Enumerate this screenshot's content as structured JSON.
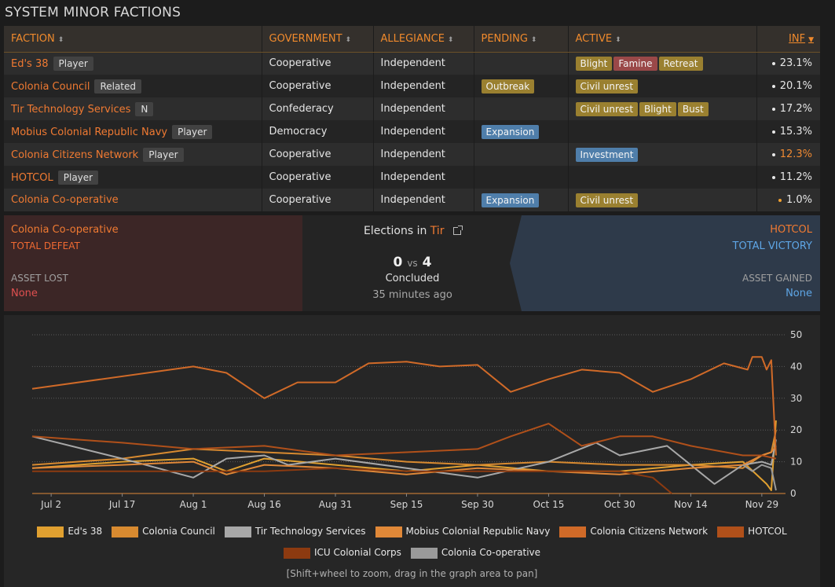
{
  "page_title": "SYSTEM MINOR FACTIONS",
  "table": {
    "headers": [
      {
        "label": "FACTION",
        "sort": "both"
      },
      {
        "label": "GOVERNMENT",
        "sort": "both"
      },
      {
        "label": "ALLEGIANCE",
        "sort": "both"
      },
      {
        "label": "PENDING",
        "sort": "both"
      },
      {
        "label": "ACTIVE",
        "sort": "both"
      },
      {
        "label": "INF",
        "sort": "desc"
      }
    ],
    "rows": [
      {
        "name": "Ed's 38",
        "tag": "Player",
        "government": "Cooperative",
        "allegiance": "Independent",
        "pending": [],
        "active": [
          {
            "label": "Blight",
            "color": "gold"
          },
          {
            "label": "Famine",
            "color": "red"
          },
          {
            "label": "Retreat",
            "color": "gold"
          }
        ],
        "inf": "23.1%",
        "inf_highlight": false
      },
      {
        "name": "Colonia Council",
        "tag": "Related",
        "government": "Cooperative",
        "allegiance": "Independent",
        "pending": [
          {
            "label": "Outbreak",
            "color": "gold"
          }
        ],
        "active": [
          {
            "label": "Civil unrest",
            "color": "gold"
          }
        ],
        "inf": "20.1%",
        "inf_highlight": false
      },
      {
        "name": "Tir Technology Services",
        "tag": "N",
        "government": "Confederacy",
        "allegiance": "Independent",
        "pending": [],
        "active": [
          {
            "label": "Civil unrest",
            "color": "gold"
          },
          {
            "label": "Blight",
            "color": "gold"
          },
          {
            "label": "Bust",
            "color": "gold"
          }
        ],
        "inf": "17.2%",
        "inf_highlight": false
      },
      {
        "name": "Mobius Colonial Republic Navy",
        "tag": "Player",
        "government": "Democracy",
        "allegiance": "Independent",
        "pending": [
          {
            "label": "Expansion",
            "color": "blue"
          }
        ],
        "active": [],
        "inf": "15.3%",
        "inf_highlight": false
      },
      {
        "name": "Colonia Citizens Network",
        "tag": "Player",
        "government": "Cooperative",
        "allegiance": "Independent",
        "pending": [],
        "active": [
          {
            "label": "Investment",
            "color": "blue"
          }
        ],
        "inf": "12.3%",
        "inf_highlight": true
      },
      {
        "name": "HOTCOL",
        "tag": "Player",
        "government": "Cooperative",
        "allegiance": "Independent",
        "pending": [],
        "active": [],
        "inf": "11.2%",
        "inf_highlight": false
      },
      {
        "name": "Colonia Co-operative",
        "tag": "",
        "government": "Cooperative",
        "allegiance": "Independent",
        "pending": [
          {
            "label": "Expansion",
            "color": "blue"
          }
        ],
        "active": [
          {
            "label": "Civil unrest",
            "color": "gold"
          }
        ],
        "inf": "1.0%",
        "inf_highlight": true
      }
    ]
  },
  "conflict": {
    "left_faction": "Colonia Co-operative",
    "left_result": "TOTAL DEFEAT",
    "left_asset_label": "ASSET LOST",
    "left_asset": "None",
    "title_prefix": "Elections in",
    "title_system": "Tir",
    "score_left": "0",
    "score_vs": "vs",
    "score_right": "4",
    "status": "Concluded",
    "time": "35 minutes ago",
    "right_faction": "HOTCOL",
    "right_result": "TOTAL VICTORY",
    "right_asset_label": "ASSET GAINED",
    "right_asset": "None"
  },
  "chart_hint": "[Shift+wheel to zoom, drag in the graph area to pan]",
  "chart_data": {
    "type": "line",
    "title": "",
    "xlabel": "",
    "ylabel": "",
    "x_ticks": [
      "Jul 2",
      "Jul 17",
      "Aug 1",
      "Aug 16",
      "Aug 31",
      "Sep 15",
      "Sep 30",
      "Oct 15",
      "Oct 30",
      "Nov 14",
      "Nov 29"
    ],
    "y_ticks": [
      0,
      10,
      20,
      30,
      40,
      50
    ],
    "ylim": [
      0,
      50
    ],
    "x_days_range": [
      -4,
      155
    ],
    "grid": true,
    "legend_position": "bottom",
    "series": [
      {
        "name": "Ed's 38",
        "color": "#e0a030",
        "points": [
          [
            -4,
            8
          ],
          [
            15,
            10
          ],
          [
            30,
            11
          ],
          [
            37,
            7
          ],
          [
            45,
            11
          ],
          [
            60,
            9
          ],
          [
            75,
            7
          ],
          [
            90,
            9
          ],
          [
            105,
            7
          ],
          [
            120,
            7
          ],
          [
            135,
            9
          ],
          [
            146,
            10
          ],
          [
            151,
            3
          ],
          [
            152,
            1
          ],
          [
            153,
            23
          ]
        ]
      },
      {
        "name": "Colonia Council",
        "color": "#d88a30",
        "points": [
          [
            -4,
            9
          ],
          [
            15,
            11
          ],
          [
            30,
            14
          ],
          [
            45,
            13
          ],
          [
            60,
            12
          ],
          [
            75,
            10
          ],
          [
            90,
            9
          ],
          [
            105,
            10
          ],
          [
            120,
            9
          ],
          [
            135,
            9
          ],
          [
            146,
            8
          ],
          [
            150,
            12
          ],
          [
            152,
            13
          ],
          [
            153,
            20
          ]
        ]
      },
      {
        "name": "Tir Technology Services",
        "color": "#a8a8a8",
        "points": [
          [
            -4,
            18
          ],
          [
            15,
            11
          ],
          [
            30,
            5
          ],
          [
            37,
            11
          ],
          [
            45,
            12
          ],
          [
            50,
            9
          ],
          [
            60,
            11
          ],
          [
            75,
            8
          ],
          [
            90,
            5
          ],
          [
            105,
            10
          ],
          [
            115,
            16
          ],
          [
            120,
            12
          ],
          [
            130,
            15
          ],
          [
            140,
            3
          ],
          [
            146,
            9
          ],
          [
            150,
            10
          ],
          [
            152,
            9
          ],
          [
            153,
            17
          ]
        ]
      },
      {
        "name": "Mobius Colonial Republic Navy",
        "color": "#e08838",
        "points": [
          [
            -4,
            8
          ],
          [
            15,
            9
          ],
          [
            30,
            10
          ],
          [
            37,
            6
          ],
          [
            45,
            9
          ],
          [
            60,
            8
          ],
          [
            75,
            6
          ],
          [
            90,
            8
          ],
          [
            105,
            7
          ],
          [
            120,
            6
          ],
          [
            135,
            8
          ],
          [
            146,
            9
          ],
          [
            150,
            12
          ],
          [
            152,
            13
          ],
          [
            153,
            15
          ]
        ]
      },
      {
        "name": "Colonia Citizens Network",
        "color": "#d06a28",
        "points": [
          [
            -4,
            33
          ],
          [
            30,
            40
          ],
          [
            37,
            38
          ],
          [
            45,
            30
          ],
          [
            52,
            35
          ],
          [
            60,
            35
          ],
          [
            67,
            41
          ],
          [
            75,
            41.5
          ],
          [
            82,
            40
          ],
          [
            90,
            40.5
          ],
          [
            97,
            32
          ],
          [
            105,
            36
          ],
          [
            112,
            39
          ],
          [
            120,
            38
          ],
          [
            127,
            32
          ],
          [
            135,
            36
          ],
          [
            142,
            41
          ],
          [
            147,
            39
          ],
          [
            148,
            43
          ],
          [
            150,
            43
          ],
          [
            151,
            39
          ],
          [
            152,
            42
          ],
          [
            153,
            12
          ]
        ]
      },
      {
        "name": "HOTCOL",
        "color": "#b0501a",
        "points": [
          [
            -4,
            18
          ],
          [
            15,
            16
          ],
          [
            30,
            14
          ],
          [
            45,
            15
          ],
          [
            60,
            12
          ],
          [
            75,
            13
          ],
          [
            90,
            14
          ],
          [
            97,
            18
          ],
          [
            105,
            22
          ],
          [
            112,
            15
          ],
          [
            120,
            18
          ],
          [
            127,
            18
          ],
          [
            135,
            15
          ],
          [
            146,
            12
          ],
          [
            150,
            12
          ],
          [
            153,
            11
          ]
        ]
      },
      {
        "name": "ICU Colonial Corps",
        "color": "#8c3a10",
        "points": [
          [
            -4,
            7
          ],
          [
            30,
            7
          ],
          [
            45,
            7
          ],
          [
            60,
            8
          ],
          [
            75,
            7
          ],
          [
            90,
            7
          ],
          [
            105,
            7
          ],
          [
            120,
            7
          ],
          [
            127,
            5
          ],
          [
            131,
            0
          ]
        ]
      },
      {
        "name": "Colonia Co-operative",
        "color": "#9a9a9a",
        "points": [
          [
            146,
            9
          ],
          [
            148,
            7
          ],
          [
            150,
            9
          ],
          [
            152,
            8
          ],
          [
            153,
            1
          ]
        ]
      }
    ]
  }
}
